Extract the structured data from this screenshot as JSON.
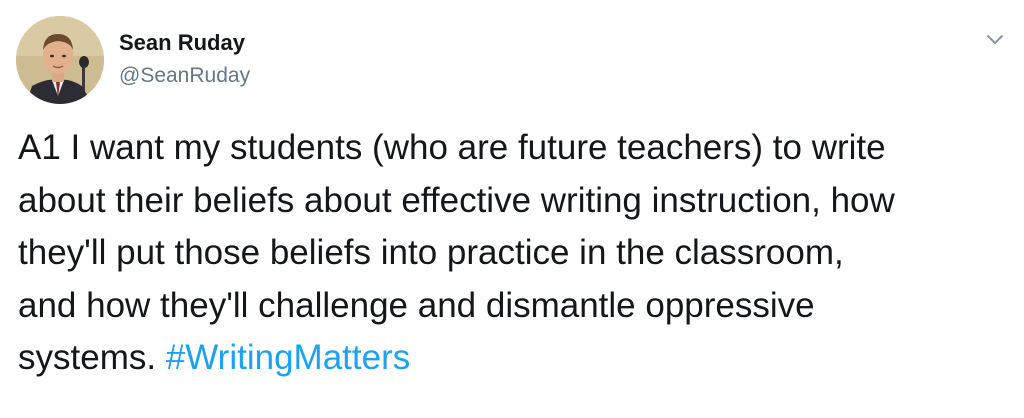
{
  "author": {
    "name": "Sean Ruday",
    "handle": "@SeanRuday"
  },
  "tweet": {
    "lines": [
      "A1 I want my students (who are future teachers) to write",
      "about their beliefs about effective writing instruction, how",
      "they'll put those beliefs into practice in the classroom,",
      "and how they'll challenge and dismantle oppressive"
    ],
    "last_line_text": "systems.",
    "hashtag": "#WritingMatters"
  },
  "icons": {
    "menu": "chevron-down-icon"
  },
  "colors": {
    "text": "#14171a",
    "secondary": "#657786",
    "link": "#1da1f2",
    "caret": "#8899a6"
  }
}
